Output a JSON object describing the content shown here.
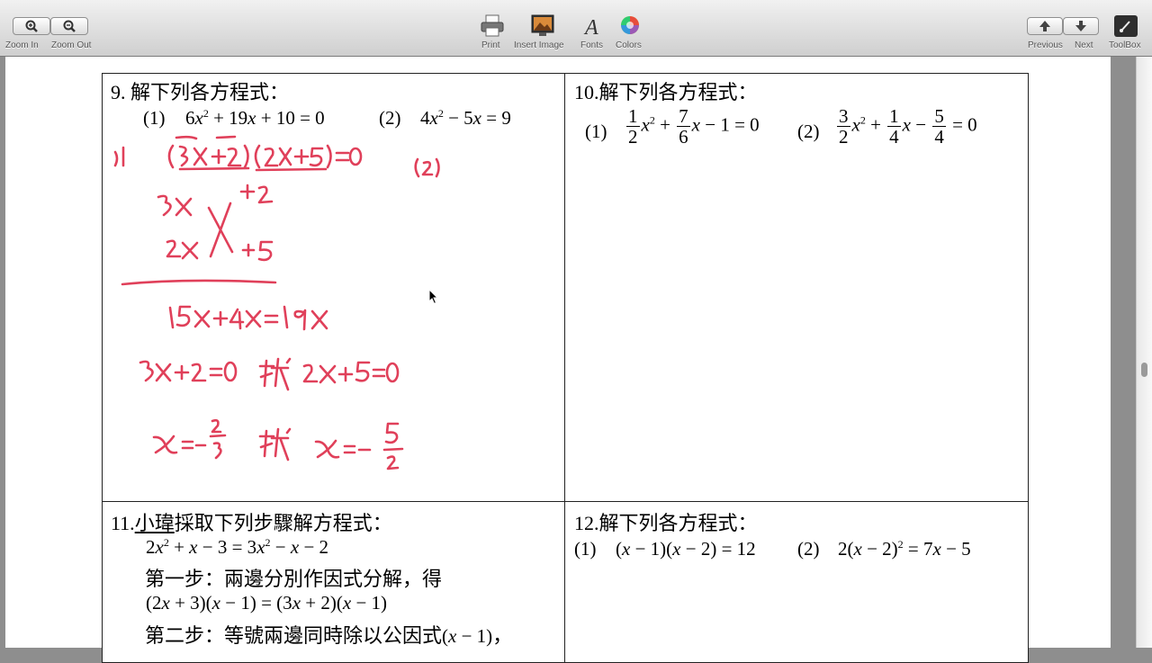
{
  "toolbar": {
    "zoom_in": "Zoom In",
    "zoom_out": "Zoom Out",
    "print": "Print",
    "insert_image": "Insert Image",
    "fonts": "Fonts",
    "colors": "Colors",
    "previous": "Previous",
    "next": "Next",
    "toolbox": "ToolBox"
  },
  "q9": {
    "title": "9.  解下列各方程式：",
    "p1_label": "(1)",
    "p2_label": "(2)"
  },
  "q10": {
    "title": "10.解下列各方程式：",
    "p1_label": "(1)",
    "p2_label": "(2)"
  },
  "q11": {
    "num": "11.",
    "name": "小瑋",
    "rest": "採取下列步驟解方程式：",
    "step1": "第一步：兩邊分別作因式分解，得",
    "step2_text": "第二步：等號兩邊同時除以公因式",
    "step2_tail": "，"
  },
  "q12": {
    "title": "12.解下列各方程式：",
    "p1_label": "(1)",
    "p2_label": "(2)"
  },
  "colors": {
    "ink": "#e0405a",
    "border": "#222222"
  }
}
